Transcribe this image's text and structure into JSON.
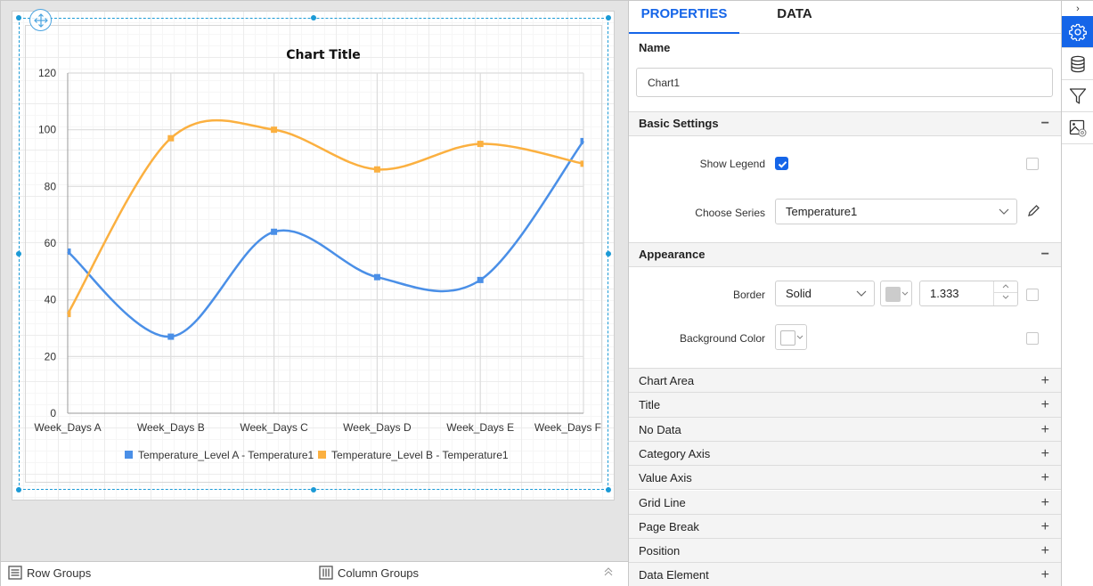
{
  "designer": {
    "groups_bar": {
      "row_groups": "Row Groups",
      "column_groups": "Column Groups"
    }
  },
  "chart_data": {
    "type": "line",
    "subtype": "spline",
    "title": "Chart Title",
    "xlabel": "",
    "ylabel": "",
    "categories": [
      "Week_Days A",
      "Week_Days B",
      "Week_Days C",
      "Week_Days D",
      "Week_Days E",
      "Week_Days F"
    ],
    "y_ticks": [
      0,
      20,
      40,
      60,
      80,
      100,
      120
    ],
    "ylim": [
      0,
      120
    ],
    "grid": true,
    "legend_position": "bottom",
    "series": [
      {
        "name": "Temperature_Level A - Temperature1",
        "color": "#4a8fe7",
        "values": [
          57,
          27,
          64,
          48,
          47,
          96
        ]
      },
      {
        "name": "Temperature_Level B - Temperature1",
        "color": "#fbb040",
        "values": [
          35,
          97,
          100,
          86,
          95,
          88
        ]
      }
    ]
  },
  "properties": {
    "tabs": [
      {
        "label": "PROPERTIES",
        "active": true
      },
      {
        "label": "DATA",
        "active": false
      }
    ],
    "name_label": "Name",
    "name_value": "Chart1",
    "basic_settings": {
      "header": "Basic Settings",
      "toggle": "−",
      "show_legend_label": "Show Legend",
      "show_legend": true,
      "choose_series_label": "Choose Series",
      "choose_series_value": "Temperature1"
    },
    "appearance": {
      "header": "Appearance",
      "toggle": "−",
      "border_label": "Border",
      "border_style": "Solid",
      "border_color": "#cccccc",
      "border_width": "1.333",
      "background_label": "Background Color",
      "background_color": "#ffffff"
    },
    "collapsed_sections": [
      {
        "label": "Chart Area",
        "toggle": "+"
      },
      {
        "label": "Title",
        "toggle": "+"
      },
      {
        "label": "No Data",
        "toggle": "+"
      },
      {
        "label": "Category Axis",
        "toggle": "+"
      },
      {
        "label": "Value Axis",
        "toggle": "+"
      },
      {
        "label": "Grid Line",
        "toggle": "+"
      },
      {
        "label": "Page Break",
        "toggle": "+"
      },
      {
        "label": "Position",
        "toggle": "+"
      },
      {
        "label": "Data Element",
        "toggle": "+"
      }
    ]
  },
  "rail": {
    "toggle": "›",
    "items": [
      "settings-icon",
      "database-icon",
      "filter-icon",
      "image-settings-icon"
    ],
    "active": "settings-icon",
    "accent": "#1565e8"
  }
}
